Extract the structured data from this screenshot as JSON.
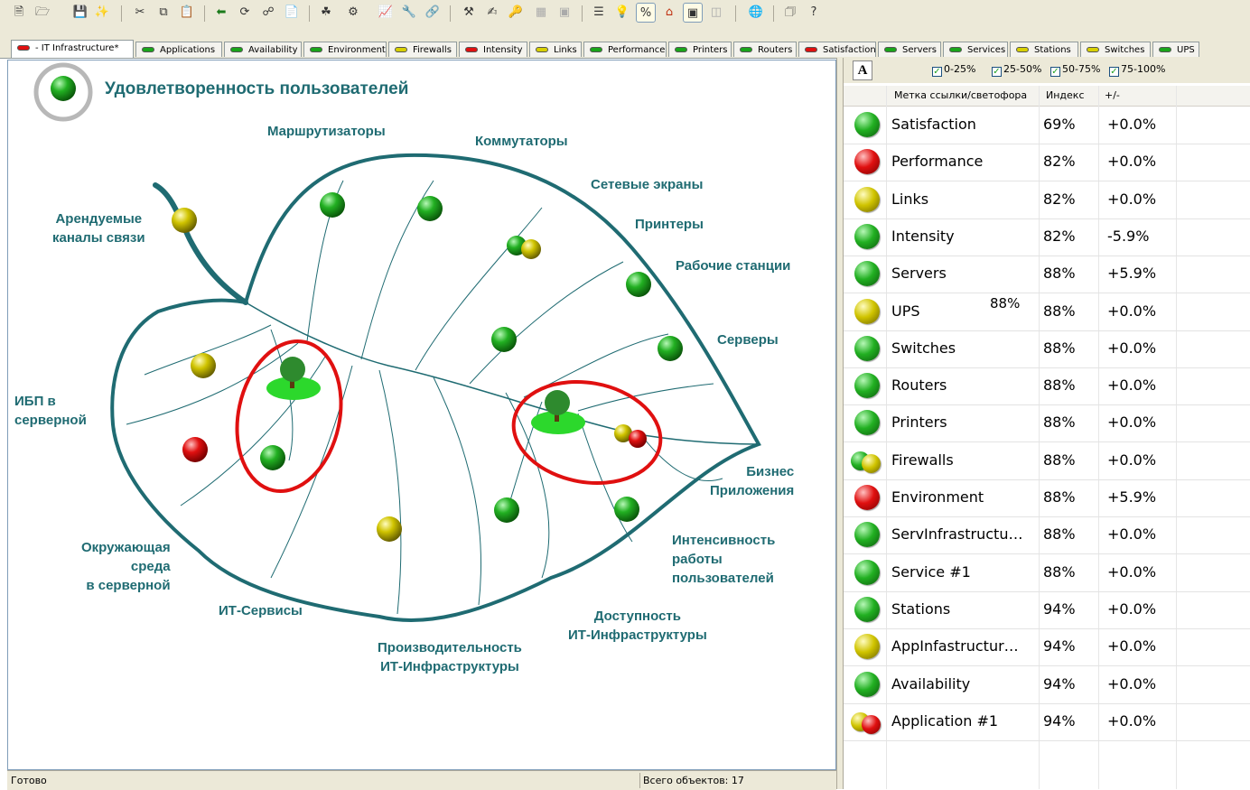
{
  "colors": {
    "green": "#1aa51a",
    "red": "#e01010",
    "yellow": "#c8c000",
    "leaf_outline": "#1f6b72",
    "label": "#1f6b72",
    "highlight_circle": "#e01010"
  },
  "toolbar": {
    "icons": [
      "new-file-icon",
      "open-folder-icon",
      "save-icon",
      "wand-icon",
      "cut-icon",
      "copy-icon",
      "paste-icon",
      "back-arrow-icon",
      "refresh-icon",
      "network-icon",
      "page-icon",
      "tree-icon",
      "config-icon",
      "chart-icon",
      "bulb-icon",
      "percent-icon",
      "home-icon",
      "frame-icon",
      "layout-icon",
      "globe-icon",
      "properties-icon",
      "help-icon"
    ]
  },
  "tabs": [
    {
      "label": "- IT Infrastructure*",
      "color": "#e01010",
      "active": true
    },
    {
      "label": "Applications",
      "color": "#1aa51a"
    },
    {
      "label": "Availability",
      "color": "#1aa51a"
    },
    {
      "label": "Environment",
      "color": "#1aa51a"
    },
    {
      "label": "Firewalls",
      "color": "#d8d000"
    },
    {
      "label": "Intensity",
      "color": "#e01010"
    },
    {
      "label": "Links",
      "color": "#d8d000"
    },
    {
      "label": "Performance",
      "color": "#1aa51a"
    },
    {
      "label": "Printers",
      "color": "#1aa51a"
    },
    {
      "label": "Routers",
      "color": "#1aa51a"
    },
    {
      "label": "Satisfaction",
      "color": "#e01010"
    },
    {
      "label": "Servers",
      "color": "#1aa51a"
    },
    {
      "label": "Services",
      "color": "#1aa51a"
    },
    {
      "label": "Stations",
      "color": "#d8d000"
    },
    {
      "label": "Switches",
      "color": "#d8d000"
    },
    {
      "label": "UPS",
      "color": "#1aa51a"
    }
  ],
  "map": {
    "title": "Удовлетворенность пользователей",
    "labels": {
      "routers": "Маршрутизаторы",
      "switches": "Коммутаторы",
      "firewalls": "Сетевые экраны",
      "printers": "Принтеры",
      "stations": "Рабочие станции",
      "servers": "Серверы",
      "links": "Арендуемые\nканалы связи",
      "ups": "ИБП в\nсерверной",
      "business_apps": "Бизнес\nПриложения",
      "intensity": "Интенсивность\nработы\nпользователей",
      "availability": "Доступность\nИТ-Инфраструктуры",
      "performance": "Производительность\nИТ-Инфраструктуры",
      "it_services": "ИТ-Сервисы",
      "environment": "Окружающая\nсреда\nв серверной"
    }
  },
  "status": {
    "left": "Готово",
    "right": "Всего объектов: 17"
  },
  "right_panel": {
    "font_button": "A",
    "filters": [
      {
        "label": "0-25%",
        "checked": true
      },
      {
        "label": "25-50%",
        "checked": true
      },
      {
        "label": "50-75%",
        "checked": true
      },
      {
        "label": "75-100%",
        "checked": true
      }
    ],
    "columns": {
      "name": "Метка ссылки/светофора",
      "index": "Индекс",
      "delta": "+/-"
    },
    "tooltip": "88%",
    "rows": [
      {
        "name": "Satisfaction",
        "index": "69%",
        "delta": "+0.0%",
        "status": "green"
      },
      {
        "name": "Performance",
        "index": "82%",
        "delta": "+0.0%",
        "status": "red"
      },
      {
        "name": "Links",
        "index": "82%",
        "delta": "+0.0%",
        "status": "yellow"
      },
      {
        "name": "Intensity",
        "index": "82%",
        "delta": "-5.9%",
        "status": "green"
      },
      {
        "name": "Servers",
        "index": "88%",
        "delta": "+5.9%",
        "status": "green"
      },
      {
        "name": "UPS",
        "index": "88%",
        "delta": "+0.0%",
        "status": "yellow"
      },
      {
        "name": "Switches",
        "index": "88%",
        "delta": "+0.0%",
        "status": "green"
      },
      {
        "name": "Routers",
        "index": "88%",
        "delta": "+0.0%",
        "status": "green"
      },
      {
        "name": "Printers",
        "index": "88%",
        "delta": "+0.0%",
        "status": "green"
      },
      {
        "name": "Firewalls",
        "index": "88%",
        "delta": "+0.0%",
        "status": "green-yellow"
      },
      {
        "name": "Environment",
        "index": "88%",
        "delta": "+5.9%",
        "status": "red"
      },
      {
        "name": "ServInfrastructu…",
        "index": "88%",
        "delta": "+0.0%",
        "status": "green"
      },
      {
        "name": "Service #1",
        "index": "88%",
        "delta": "+0.0%",
        "status": "green"
      },
      {
        "name": "Stations",
        "index": "94%",
        "delta": "+0.0%",
        "status": "green"
      },
      {
        "name": "AppInfastructur…",
        "index": "94%",
        "delta": "+0.0%",
        "status": "yellow"
      },
      {
        "name": "Availability",
        "index": "94%",
        "delta": "+0.0%",
        "status": "green"
      },
      {
        "name": "Application #1",
        "index": "94%",
        "delta": "+0.0%",
        "status": "yellow-red"
      }
    ]
  }
}
